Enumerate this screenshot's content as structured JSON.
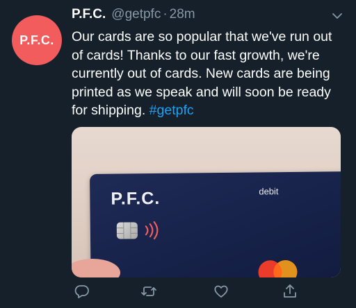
{
  "tweet": {
    "avatar_text": "P.F.C.",
    "author_name": "P.F.C.",
    "author_handle": "@getpfc",
    "separator": "·",
    "timestamp": "28m",
    "text": "Our cards are so popular that we've run out of cards! Thanks to our fast growth, we're currently out of cards. New cards are being printed as we speak and will soon be ready for shipping.",
    "hashtag": "#getpfc"
  },
  "media": {
    "card_brand": "P.F.C.",
    "card_type": "debit"
  },
  "icons": {
    "reply": "reply-icon",
    "retweet": "retweet-icon",
    "like": "heart-icon",
    "share": "share-icon",
    "more": "chevron-down-icon"
  },
  "colors": {
    "background": "#15202b",
    "secondary_text": "#8899a6",
    "hashtag": "#1da1f2",
    "brand_red": "#f25c5c",
    "card_navy": "#17224a"
  }
}
